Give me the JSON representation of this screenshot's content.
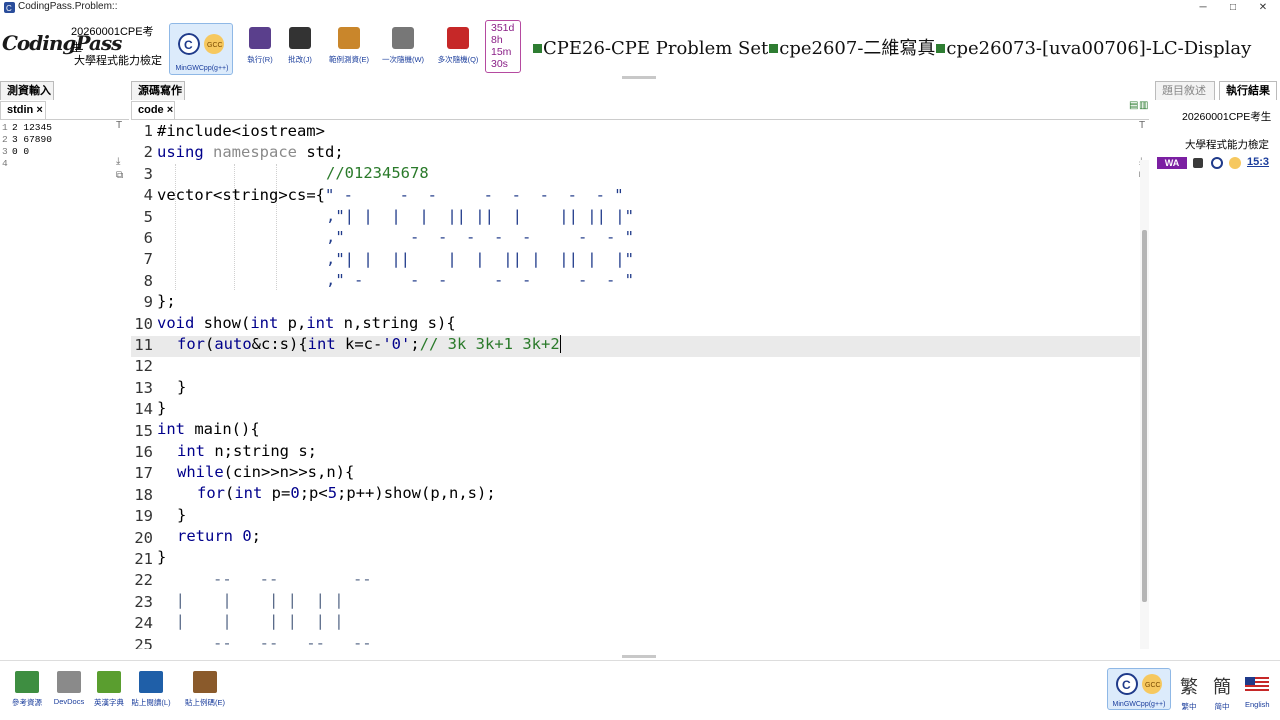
{
  "window": {
    "title": "CodingPass.Problem::",
    "minimize": "─",
    "maximize": "□",
    "close": "✕"
  },
  "toolbar": {
    "logo": "CodingPass",
    "exam_id": "20260001CPE考生",
    "exam_name": "大學程式能力檢定",
    "compiler_label": "MinGWCpp(g++)",
    "tools": [
      {
        "icon": "cube-icon",
        "label": "執行(R)",
        "color": "#5a3f8c"
      },
      {
        "icon": "checkered-flag-icon",
        "label": "批改(J)",
        "color": "#333333"
      },
      {
        "icon": "box-icon",
        "label": "範例測資(E)",
        "color": "#c9862b"
      },
      {
        "icon": "dice-icon",
        "label": "一次隨機(W)",
        "color": "#777777"
      },
      {
        "icon": "red-dice-icon",
        "label": "多次隨機(Q)",
        "color": "#c62828"
      }
    ],
    "timer": [
      "351d",
      "8h",
      "15m",
      "30s"
    ],
    "headline_parts": [
      "CPE26-CPE Problem Set",
      "cpe2607-二維寫真",
      "cpe26073-[uva00706]-LC-Display"
    ]
  },
  "left_pane": {
    "title": "測資輸入",
    "tab": "stdin ×",
    "lines": [
      {
        "n": "1",
        "text": "2 12345"
      },
      {
        "n": "2",
        "text": "3 67890"
      },
      {
        "n": "3",
        "text": "0 0"
      },
      {
        "n": "4",
        "text": ""
      }
    ]
  },
  "code_pane": {
    "title": "源碼寫作",
    "tab": "code ×",
    "lines": [
      "1",
      "2",
      "3",
      "4",
      "5",
      "6",
      "7",
      "8",
      "9",
      "10",
      "11",
      "12",
      "13",
      "14",
      "15",
      "16",
      "17",
      "18",
      "19",
      "20",
      "21",
      "22",
      "23",
      "24",
      "25"
    ],
    "code": {
      "l1": "#include<iostream>",
      "l2a": "using",
      "l2b": " namespace",
      "l2c": " std;",
      "l3": "//012345678",
      "l4a": "vector<",
      "l4b": "string",
      "l4c": ">cs={",
      "l4d": "\" -     -  -     -  -  -  -  - \"",
      "l5": ",\"| |  |  |  || ||  |    || || |\"",
      "l6": ",\"       -  -  -  -  -     -  - \"",
      "l7": ",\"| |  ||    |  |  || |  || |  |\"",
      "l8": ",\" -     -  -     -  -     -  - \"",
      "l9": "};",
      "l10a": "void",
      "l10b": " show(",
      "l10c": "int",
      "l10d": " p,",
      "l10e": "int",
      "l10f": " n,",
      "l10g": "string",
      "l10h": " s){",
      "l11a": "for",
      "l11b": "(",
      "l11c": "auto",
      "l11d": "&c:s){",
      "l11e": "int",
      "l11f": " k=c-",
      "l11g": "'0'",
      "l11h": ";",
      "l11i": "// 3k 3k+1 3k+2",
      "l13": "}",
      "l14": "}",
      "l15a": "int",
      "l15b": " main(){",
      "l16a": "int",
      "l16b": " n;",
      "l16c": "string",
      "l16d": " s;",
      "l17a": "while",
      "l17b": "(cin>>n>>s,n){",
      "l18a": "for",
      "l18b": "(",
      "l18c": "int",
      "l18d": " p=",
      "l18e": "0",
      "l18f": ";p<",
      "l18g": "5",
      "l18h": ";p++)show(p,n,s);",
      "l19": "}",
      "l20a": "return",
      "l20b": " 0",
      "l20c": ";",
      "l21": "}",
      "l22": "      --   --        --",
      "l23": "  |    |    | |  | |",
      "l24": "  |    |    | |  | |",
      "l25": "      --   --   --   --"
    }
  },
  "right_pane": {
    "tab_problem": "題目敘述",
    "tab_result": "執行結果",
    "exam_id": "20260001CPE考生",
    "exam_name": "大學程式能力檢定",
    "clock": "15:3"
  },
  "bottom_bar": {
    "tools": [
      {
        "icon": "books-icon",
        "label": "參考資源"
      },
      {
        "icon": "magnifier-icon",
        "label": "DevDocs"
      },
      {
        "icon": "green-book-icon",
        "label": "英漢字典"
      },
      {
        "icon": "clipboard-icon",
        "label": "貼上閱讀(L)"
      },
      {
        "icon": "open-book-icon",
        "label": "貼上例碼(E)"
      }
    ],
    "compiler_label": "MinGWCpp(g++)",
    "lang_trad": "繁",
    "lang_trad_cap": "繁中",
    "lang_simp": "簡",
    "lang_simp_cap": "简中",
    "lang_en_cap": "English"
  }
}
